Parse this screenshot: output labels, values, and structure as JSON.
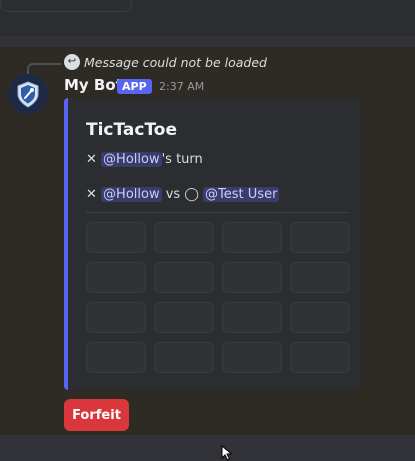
{
  "reply": {
    "text": "Message could not be loaded"
  },
  "bot": {
    "name": "My Bot",
    "badge": "APP",
    "time": "2:37 AM"
  },
  "embed": {
    "title": "TicTacToe",
    "turn": {
      "symbol": "✕",
      "mention": "@Hollow",
      "suffix": "'s turn"
    },
    "players": {
      "symbol1": "✕",
      "mention1": "@Hollow",
      "vs": "vs",
      "symbol2": "◯",
      "mention2": "@Test User"
    },
    "accent_color": "#5865f2"
  },
  "board": {
    "rows": 4,
    "cols": 4
  },
  "actions": {
    "forfeit_label": "Forfeit",
    "forfeit_color": "#da373c"
  }
}
